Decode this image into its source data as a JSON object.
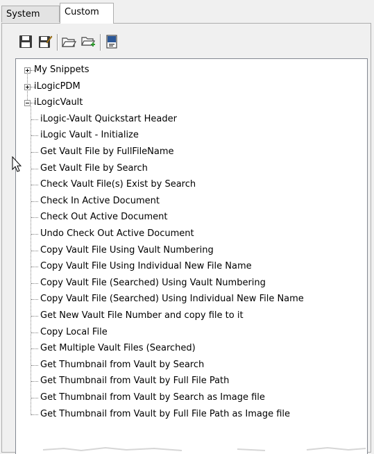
{
  "tabs": [
    {
      "label": "System",
      "active": false
    },
    {
      "label": "Custom",
      "active": true
    }
  ],
  "toolbar": {
    "buttons": [
      {
        "icon": "save-icon"
      },
      {
        "icon": "save-as-icon"
      },
      {
        "icon": "open-folder-icon"
      },
      {
        "icon": "add-folder-icon"
      },
      {
        "icon": "window-icon"
      }
    ]
  },
  "tree": {
    "roots": [
      {
        "label": "My Snippets",
        "expanded": false
      },
      {
        "label": "iLogicPDM",
        "expanded": false
      },
      {
        "label": "iLogicVault",
        "expanded": true
      }
    ],
    "children": [
      "iLogic-Vault Quickstart Header",
      "iLogic Vault - Initialize",
      "Get Vault File by FullFileName",
      "Get Vault File by Search",
      "Check Vault File(s) Exist by Search",
      "Check In Active Document",
      "Check Out Active Document",
      "Undo Check Out Active Document",
      "Copy Vault File Using Vault Numbering",
      "Copy Vault File Using Individual New File Name",
      "Copy Vault File (Searched) Using Vault Numbering",
      "Copy Vault File (Searched) Using Individual New File Name",
      "Get New Vault File Number and copy file to it",
      "Copy Local File",
      "Get Multiple Vault Files (Searched)",
      "Get Thumbnail from Vault by Search",
      "Get Thumbnail from Vault by Full File Path",
      "Get Thumbnail from Vault by Search as Image file",
      "Get Thumbnail from Vault by Full File Path as Image file"
    ]
  },
  "colors": {
    "panel_bg": "#f0f0f0",
    "tree_bg": "#ffffff",
    "border": "#adadad",
    "icon_blue": "#2b5797"
  }
}
